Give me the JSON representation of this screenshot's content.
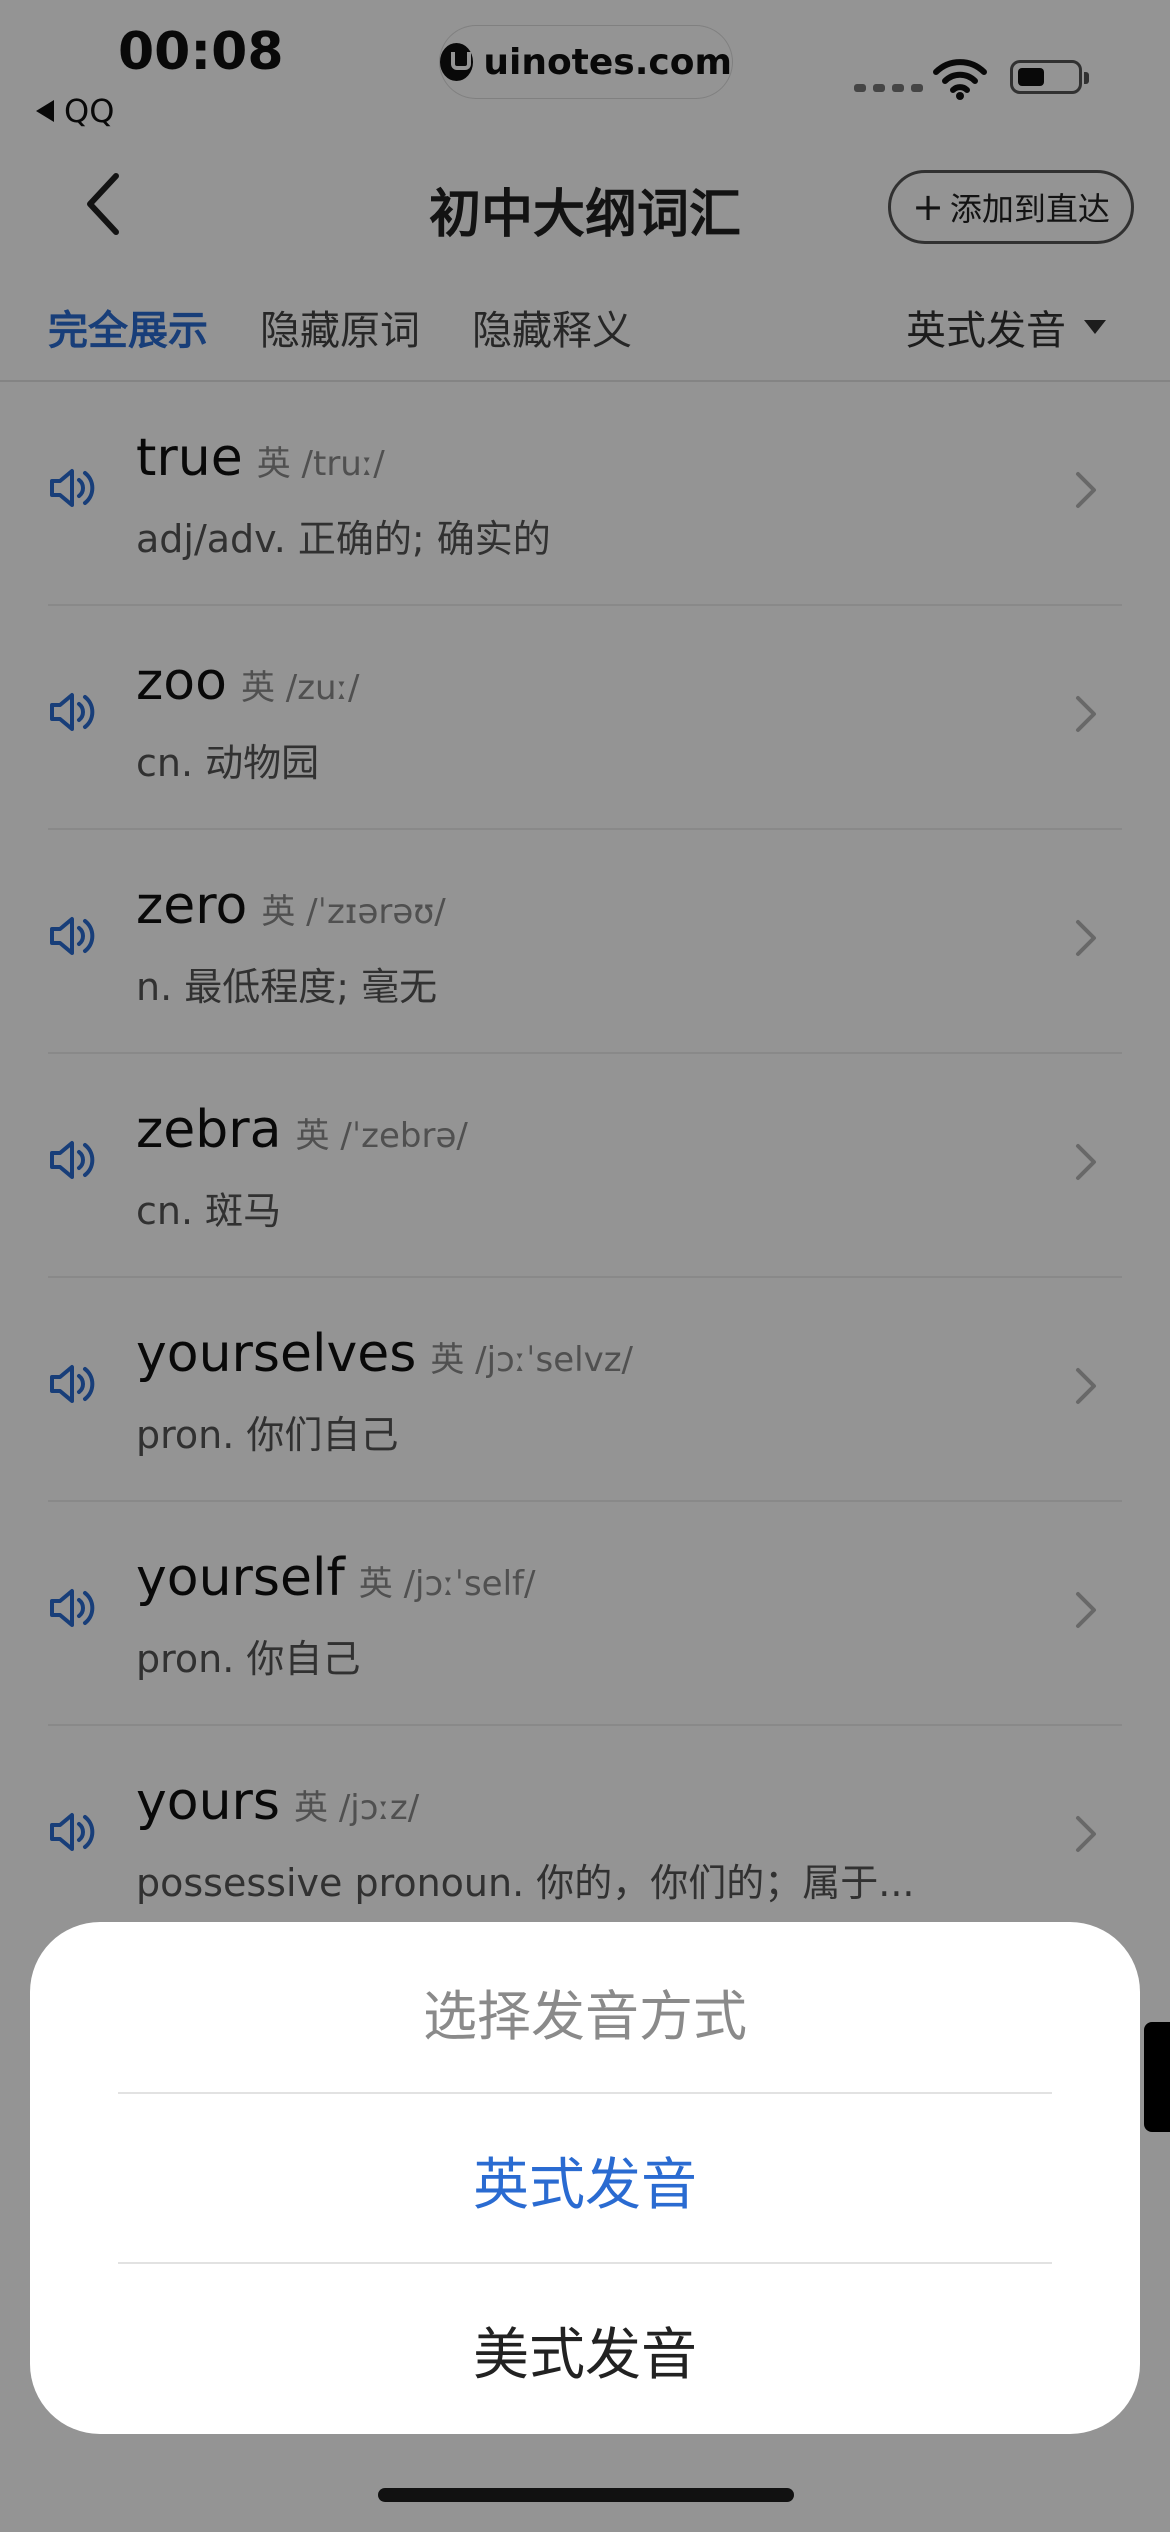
{
  "status_bar": {
    "time": "00:08",
    "back_app": "QQ",
    "url": "uinotes.com"
  },
  "nav": {
    "title": "初中大纲词汇",
    "add_button": "添加到直达"
  },
  "tabs": [
    {
      "label": "完全展示",
      "active": true
    },
    {
      "label": "隐藏原词",
      "active": false
    },
    {
      "label": "隐藏释义",
      "active": false
    }
  ],
  "pronunciation_select": "英式发音",
  "words": [
    {
      "word": "true",
      "region": "英",
      "ipa": "/truː/",
      "meaning": "adj/adv. 正确的; 确实的"
    },
    {
      "word": "zoo",
      "region": "英",
      "ipa": "/zuː/",
      "meaning": "cn. 动物园"
    },
    {
      "word": "zero",
      "region": "英",
      "ipa": "/ˈzɪərəʊ/",
      "meaning": "n. 最低程度; 毫无"
    },
    {
      "word": "zebra",
      "region": "英",
      "ipa": "/ˈzebrə/",
      "meaning": "cn. 斑马"
    },
    {
      "word": "yourselves",
      "region": "英",
      "ipa": "/jɔːˈselvz/",
      "meaning": "pron. 你们自己"
    },
    {
      "word": "yourself",
      "region": "英",
      "ipa": "/jɔːˈself/",
      "meaning": "pron. 你自己"
    },
    {
      "word": "yours",
      "region": "英",
      "ipa": "/jɔːz/",
      "meaning": "possessive pronoun. 你的，你们的；属于..."
    }
  ],
  "sheet": {
    "title": "选择发音方式",
    "option_uk": "英式发音",
    "option_us": "美式发音"
  },
  "colors": {
    "accent": "#2a6bd1",
    "overlay": "rgba(0,0,0,0.42)"
  }
}
